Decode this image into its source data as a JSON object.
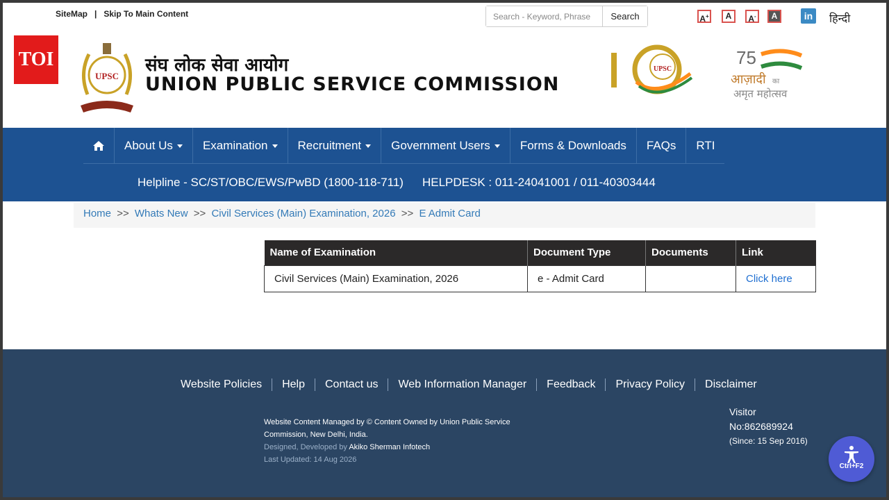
{
  "topbar": {
    "sitemap": "SiteMap",
    "separator": "|",
    "skip": "Skip To Main Content",
    "search_placeholder": "Search - Keyword, Phrase",
    "search_button": "Search",
    "font_larger": "A",
    "font_normal": "A",
    "font_smaller": "A",
    "font_contrast": "A",
    "linkedin": "in",
    "hindi": "हिन्दी"
  },
  "header": {
    "toi": "TOI",
    "emblem_text": "UPSC",
    "hindi_title": "संघ लोक सेवा आयोग",
    "english_title": "UNION PUBLIC SERVICE COMMISSION",
    "logo100_text": "UPSC",
    "azadi_line1": "आज़ादी",
    "azadi_ka": "का",
    "azadi_line2": "अमृत महोत्सव"
  },
  "nav": {
    "items": [
      {
        "label": "About Us"
      },
      {
        "label": "Examination"
      },
      {
        "label": "Recruitment"
      },
      {
        "label": "Government Users"
      },
      {
        "label": "Forms & Downloads"
      },
      {
        "label": "FAQs"
      },
      {
        "label": "RTI"
      }
    ],
    "helpline": "Helpline - SC/ST/OBC/EWS/PwBD (1800-118-711)",
    "helpdesk": "HELPDESK : 011-24041001 / 011-40303444"
  },
  "breadcrumb": {
    "home": "Home",
    "sep": ">>",
    "whats_new": "Whats New",
    "exam": "Civil Services (Main) Examination, 2026",
    "current": "E Admit Card"
  },
  "table": {
    "headers": [
      "Name of Examination",
      "Document Type",
      "Documents",
      "Link"
    ],
    "rows": [
      {
        "name": "Civil Services (Main) Examination, 2026",
        "type": "e - Admit Card",
        "documents": "",
        "link": "Click here"
      }
    ]
  },
  "footer": {
    "links": [
      "Website Policies",
      "Help",
      "Contact us",
      "Web Information Manager",
      "Feedback",
      "Privacy Policy",
      "Disclaimer"
    ],
    "managed": "Website Content Managed by © Content Owned by Union Public Service Commission, New Delhi, India.",
    "designed_label": "Designed, Developed by",
    "designed_by": "Akiko Sherman Infotech",
    "last_updated": "Last Updated: 14 Aug 2026",
    "visitor_label": "Visitor",
    "visitor_no": "No:862689924",
    "visitor_since": "(Since: 15 Sep 2016)"
  },
  "accessibility": {
    "label": "Ctrl+F2"
  },
  "colors": {
    "nav_bg": "#1d5292",
    "footer_bg": "#2b4563",
    "link": "#337ab7",
    "accessibility": "#4f5bd5"
  }
}
